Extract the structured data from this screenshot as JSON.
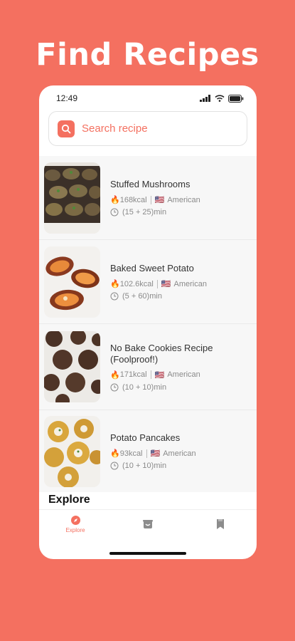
{
  "headline": "Find Recipes",
  "status_bar": {
    "time": "12:49"
  },
  "search": {
    "placeholder": "Search recipe"
  },
  "recipes": [
    {
      "title": "Stuffed Mushrooms",
      "kcal": "168kcal",
      "flag": "🇺🇸",
      "cuisine": "American",
      "time": "(15 + 25)min"
    },
    {
      "title": "Baked Sweet Potato",
      "kcal": "102.6kcal",
      "flag": "🇺🇸",
      "cuisine": "American",
      "time": "(5 + 60)min"
    },
    {
      "title": "No Bake Cookies Recipe (Foolproof!)",
      "kcal": "171kcal",
      "flag": "🇺🇸",
      "cuisine": "American",
      "time": "(10 + 10)min"
    },
    {
      "title": "Potato Pancakes",
      "kcal": "93kcal",
      "flag": "🇺🇸",
      "cuisine": "American",
      "time": "(10 + 10)min"
    }
  ],
  "section": {
    "explore_title": "Explore"
  },
  "tabs": [
    {
      "label": "Explore",
      "icon": "compass-icon",
      "active": true
    },
    {
      "label": "",
      "icon": "pot-icon",
      "active": false
    },
    {
      "label": "",
      "icon": "bookmark-icon",
      "active": false
    }
  ],
  "colors": {
    "brand": "#F47060",
    "active_tab": "#F47060",
    "inactive_tab": "#8C8C8C"
  }
}
